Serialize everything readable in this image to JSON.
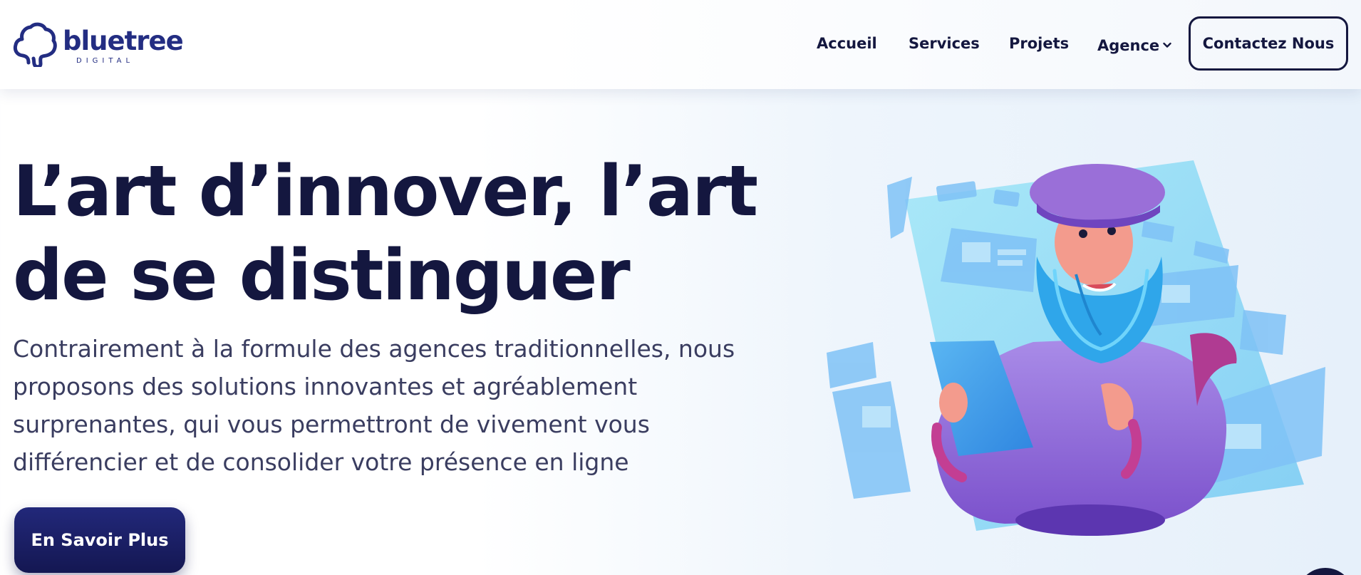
{
  "brand": {
    "name": "bluetree",
    "subtitle": "DIGITAL",
    "color": "#232d82"
  },
  "nav": {
    "items": [
      {
        "label": "Accueil"
      },
      {
        "label": "Services"
      },
      {
        "label": "Projets"
      },
      {
        "label": "Agence",
        "has_dropdown": true
      }
    ],
    "cta_label": "Contactez Nous"
  },
  "hero": {
    "title_line1": "L’art d’innover, l’art",
    "title_line2": "de se distinguer",
    "text_lines": [
      "Contrairement à la formule des agences traditionnelles, nous",
      "proposons des solutions innovantes et agréablement",
      "surprenantes, qui vous permettront de vivement vous",
      "différencier et de consolider votre présence en ligne"
    ],
    "button_label": "En Savoir Plus",
    "illustration_icon": "bearded-man-with-tablet-illustration"
  },
  "colors": {
    "primary_dark": "#14173f",
    "button_navy": "#1b1f66",
    "illustration_blue": "#6fc4f5",
    "illustration_purple": "#8a63d2"
  }
}
